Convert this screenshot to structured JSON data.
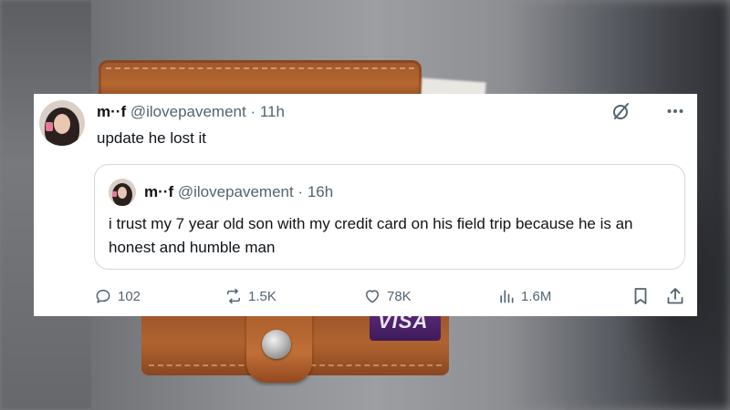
{
  "tweet": {
    "author_name": "m··f",
    "handle_time": "@ilovepavement · 11h",
    "text": "update he lost it"
  },
  "quoted_tweet": {
    "author_name": "m··f",
    "handle_time": "@ilovepavement · 16h",
    "text": "i trust my 7 year old son with my credit card on his field trip because he is an honest and humble man"
  },
  "metrics": {
    "replies": "102",
    "reposts": "1.5K",
    "likes": "78K",
    "views": "1.6M"
  },
  "background": {
    "card_brand": "VISA"
  },
  "colors": {
    "text_primary": "#0f1419",
    "text_secondary": "#536471",
    "border": "#cfd9de",
    "wallet_leather": "#b0632f"
  },
  "icons": [
    "grok-icon",
    "more-icon",
    "reply-icon",
    "repost-icon",
    "like-icon",
    "views-icon",
    "bookmark-icon",
    "share-icon"
  ]
}
